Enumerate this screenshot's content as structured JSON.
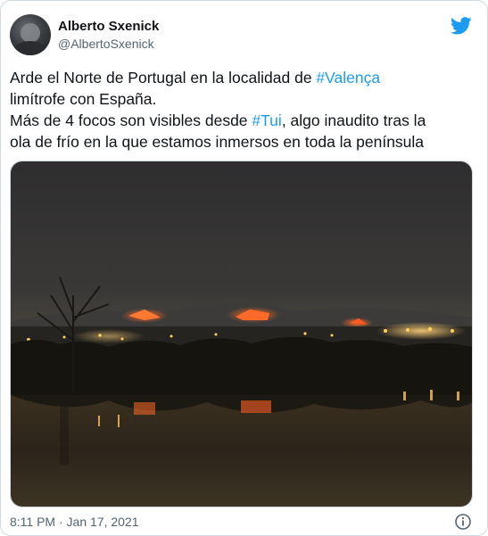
{
  "tweet": {
    "author_name": "Alberto Sxenick",
    "author_handle": "@AlbertoSxenick",
    "line1_pre": "Arde el Norte de Portugal en la localidad de ",
    "hashtag1": "#Valença",
    "line2": "limítrofe con España.",
    "line3_pre": "Más de 4 focos son visibles desde ",
    "hashtag2": "#Tui",
    "line3_post": ", algo inaudito tras la",
    "line4": "ola de frío en la que estamos inmersos en toda la península",
    "timestamp": "8:11 PM · Jan 17, 2021"
  },
  "icons": {
    "brand": "twitter-bird-icon",
    "info": "info-icon"
  },
  "colors": {
    "accent": "#1d9bf0",
    "text": "#0f1419",
    "secondary": "#536471",
    "border": "#cfd9de"
  }
}
